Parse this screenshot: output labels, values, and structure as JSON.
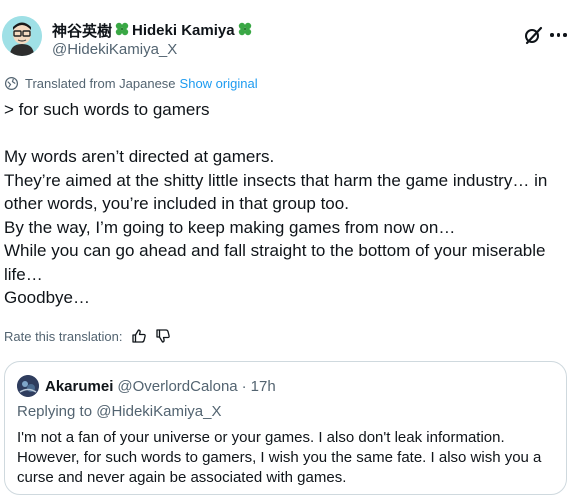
{
  "author": {
    "display_name": "神谷英樹",
    "display_name_latin": "Hideki Kamiya",
    "handle": "@HidekiKamiya_X"
  },
  "translation": {
    "note": "Translated from Japanese",
    "show_original": "Show original"
  },
  "tweet": {
    "text": "> for such words to gamers\n\nMy words aren’t directed at gamers.\nThey’re aimed at the shitty little insects that harm the game industry… in other words, you’re included in that group too.\nBy the way, I’m going to keep making games from now on…\nWhile you can go ahead and fall straight to the bottom of your miserable life…\nGoodbye…"
  },
  "rate": {
    "label": "Rate this translation:"
  },
  "quote": {
    "name": "Akarumei",
    "handle": "@OverlordCalona",
    "separator": "·",
    "time": "17h",
    "replying_to": "Replying to @HidekiKamiya_X",
    "text": "I'm not a fan of your universe or your games. I also don't leak information. However, for such words to gamers, I wish you the same fate. I also wish you a curse and never again be associated with games."
  },
  "colors": {
    "accent": "#1d9bf0",
    "secondary_text": "#536471",
    "border": "#cfd9de"
  },
  "icons": [
    "clover-icon",
    "grok-icon",
    "more-icon",
    "globe-icon",
    "thumbs-up-icon",
    "thumbs-down-icon"
  ]
}
